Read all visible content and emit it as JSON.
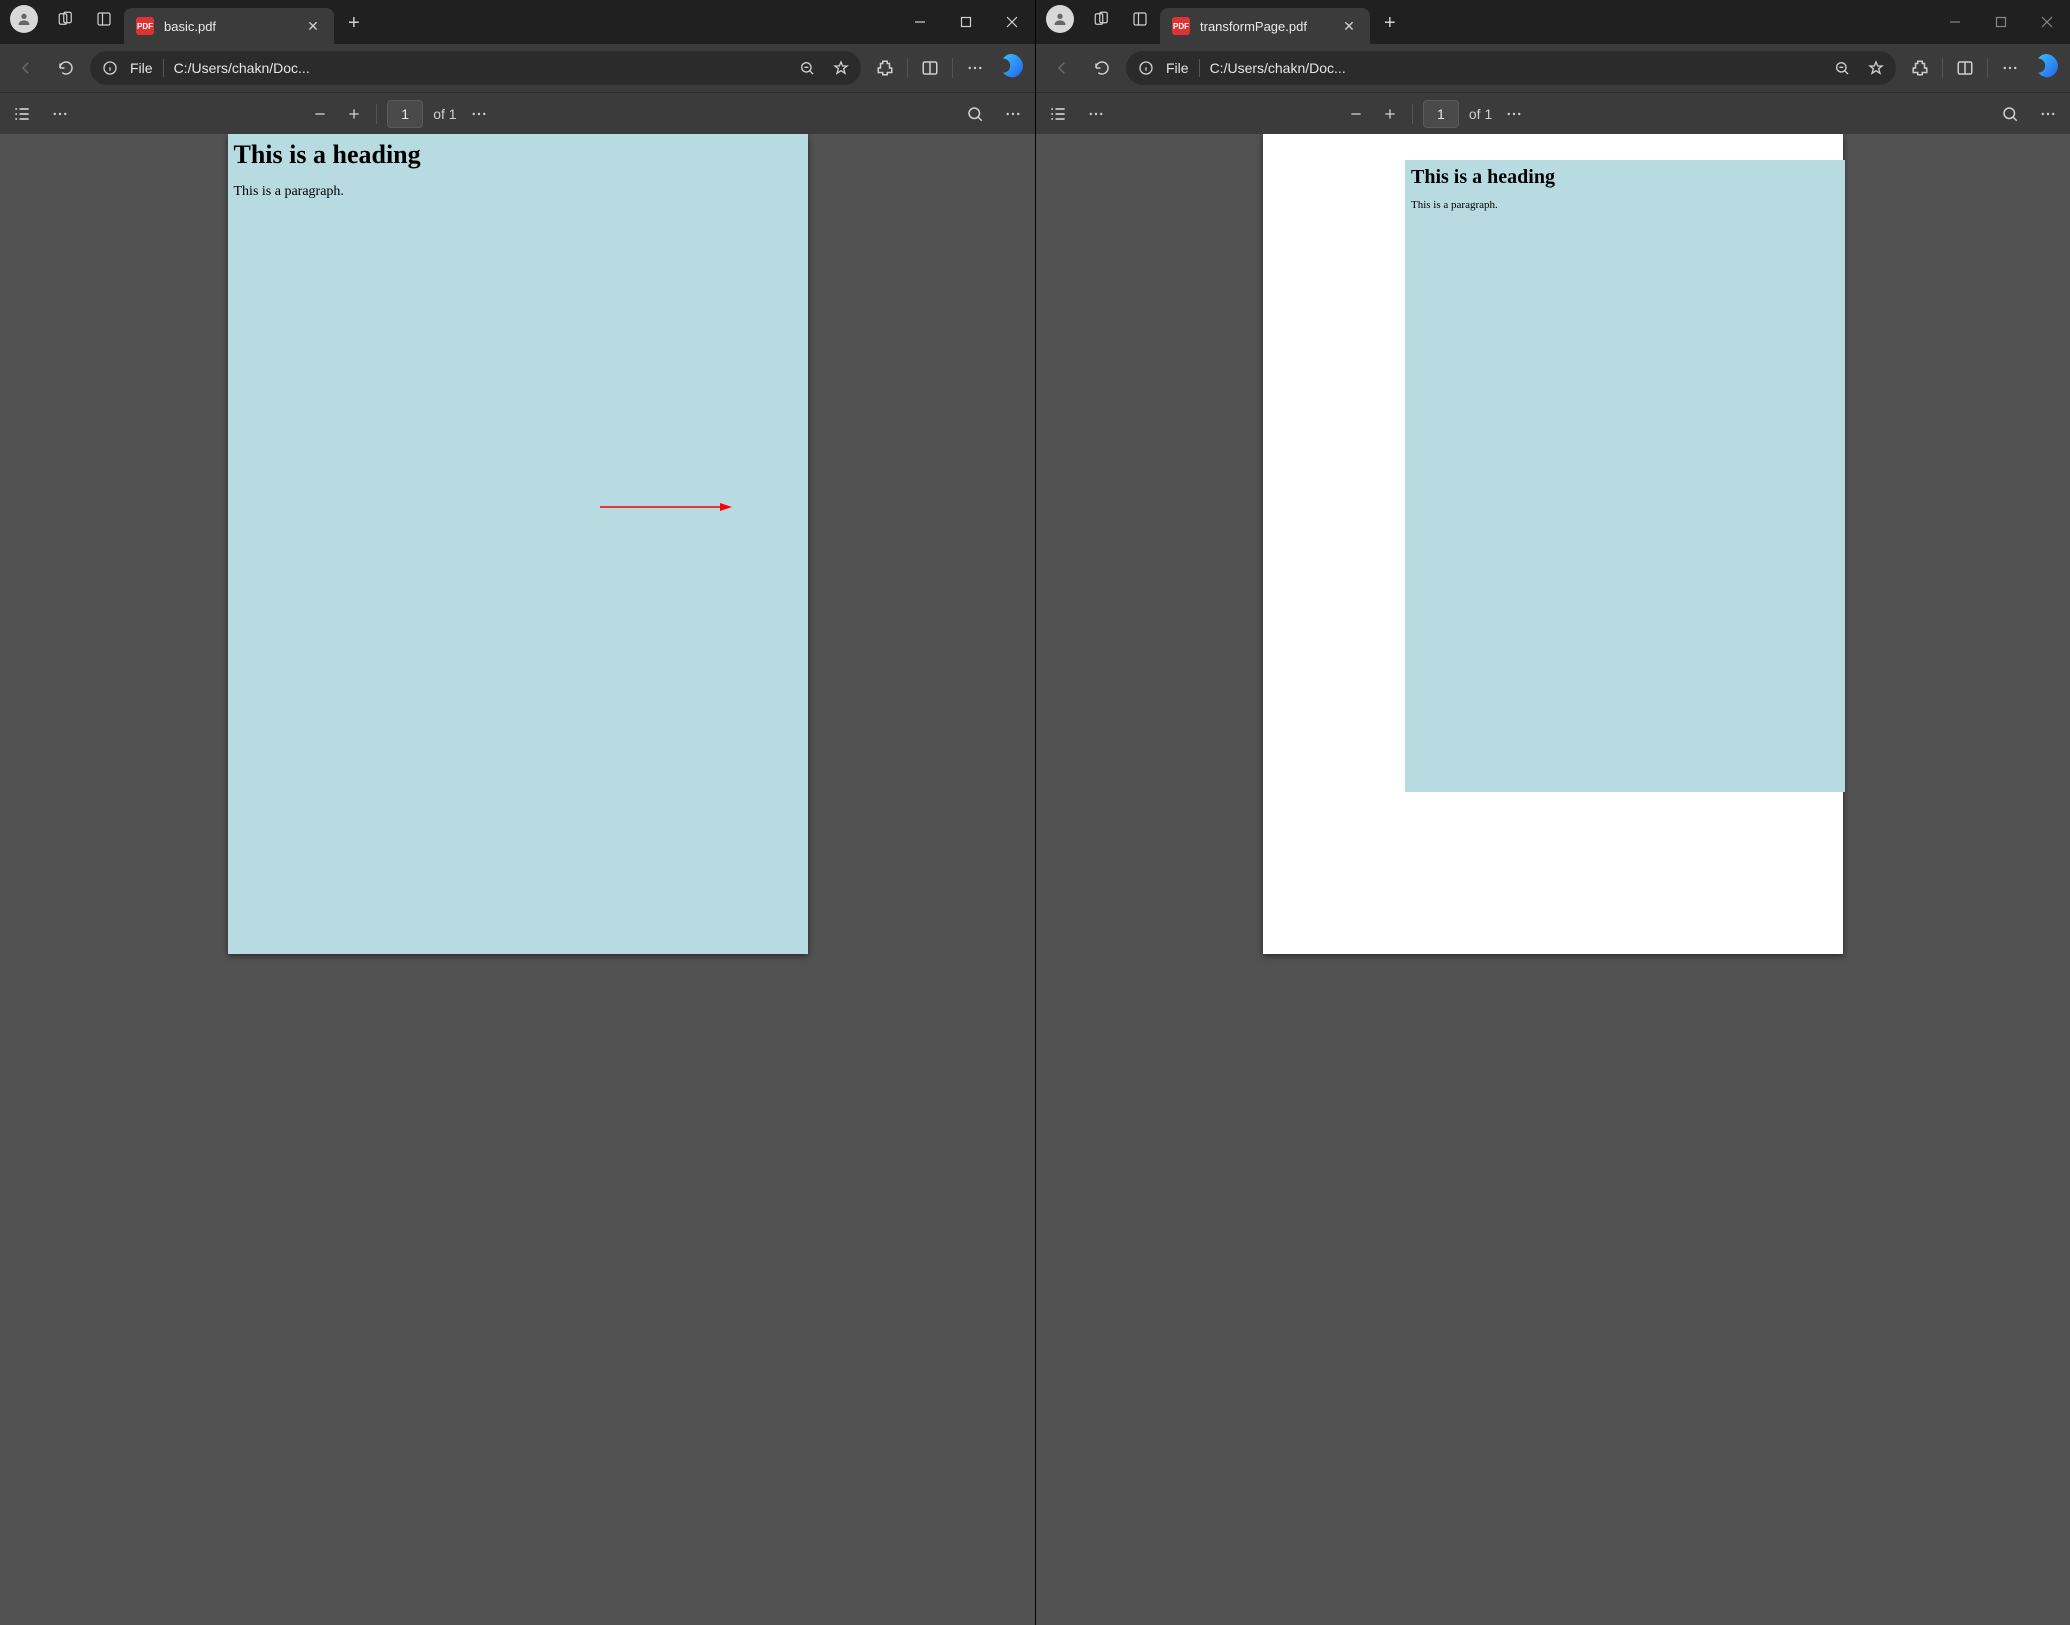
{
  "left": {
    "tab_title": "basic.pdf",
    "url_scheme": "File",
    "url_path": "C:/Users/chakn/Doc...",
    "page_current": "1",
    "page_total": "of 1",
    "doc": {
      "heading": "This is a heading",
      "paragraph": "This is a paragraph."
    }
  },
  "right": {
    "tab_title": "transformPage.pdf",
    "url_scheme": "File",
    "url_path": "C:/Users/chakn/Doc...",
    "page_current": "1",
    "page_total": "of 1",
    "doc": {
      "heading": "This is a heading",
      "paragraph": "This is a paragraph."
    }
  },
  "pdf_badge_text": "PDF"
}
